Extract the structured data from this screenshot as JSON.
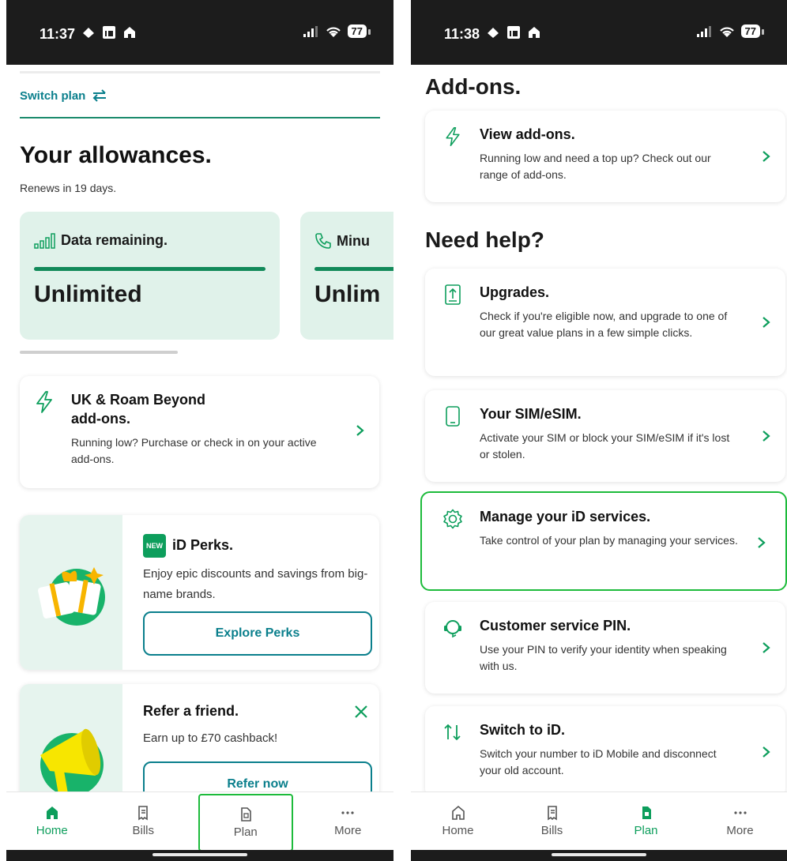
{
  "left": {
    "status": {
      "time": "11:37",
      "battery": "77"
    },
    "switch_plan": "Switch plan",
    "allowances_title": "Your allowances.",
    "renews": "Renews in 19 days.",
    "allowance_cards": [
      {
        "label": "Data remaining.",
        "value": "Unlimited",
        "icon": "signal-bars-icon"
      },
      {
        "label": "Minu",
        "value": "Unlim",
        "icon": "phone-icon"
      }
    ],
    "addons_card": {
      "title_line1": "UK & Roam Beyond",
      "title_line2": "add-ons.",
      "subtitle": "Running low? Purchase or check in on your active add-ons."
    },
    "perks_card": {
      "badge": "NEW",
      "title": "iD Perks.",
      "subtitle": "Enjoy epic discounts and savings from big-name brands.",
      "button": "Explore Perks"
    },
    "refer_card": {
      "title": "Refer a friend.",
      "subtitle": "Earn up to £70 cashback!",
      "button": "Refer now"
    },
    "nav": [
      {
        "label": "Home",
        "icon": "home-icon",
        "active": true
      },
      {
        "label": "Bills",
        "icon": "bills-icon",
        "active": false
      },
      {
        "label": "Plan",
        "icon": "plan-icon",
        "active": false,
        "highlighted": true
      },
      {
        "label": "More",
        "icon": "more-icon",
        "active": false
      }
    ]
  },
  "right": {
    "status": {
      "time": "11:38",
      "battery": "77"
    },
    "addons_title": "Add-ons.",
    "addons_card": {
      "title": "View add-ons.",
      "subtitle": "Running low and need a top up? Check out our range of add-ons.",
      "icon": "lightning-icon"
    },
    "help_title": "Need help?",
    "help_cards": [
      {
        "title": "Upgrades.",
        "subtitle": "Check if you're eligible now, and upgrade to one of our great value plans in a few simple clicks.",
        "icon": "upgrade-phone-icon"
      },
      {
        "title": "Your SIM/eSIM.",
        "subtitle": "Activate your SIM or block your SIM/eSIM if it's lost or stolen.",
        "icon": "phone-icon"
      },
      {
        "title": "Manage your iD services.",
        "subtitle": "Take control of your plan by managing your services.",
        "icon": "gear-icon"
      },
      {
        "title": "Customer service PIN.",
        "subtitle": "Use your PIN to verify your identity when speaking with us.",
        "icon": "headset-icon"
      },
      {
        "title": "Switch to iD.",
        "subtitle": "Switch your number to iD Mobile and disconnect your old account.",
        "icon": "switch-arrows-icon"
      }
    ],
    "nav": [
      {
        "label": "Home",
        "icon": "home-icon",
        "active": false
      },
      {
        "label": "Bills",
        "icon": "bills-icon",
        "active": false
      },
      {
        "label": "Plan",
        "icon": "plan-icon",
        "active": true
      },
      {
        "label": "More",
        "icon": "more-icon",
        "active": false
      }
    ]
  },
  "colors": {
    "brand_green": "#0d9e5c",
    "teal": "#0a7f8c",
    "highlight": "#1dbb3b",
    "card_mint": "#e0f2ea"
  }
}
